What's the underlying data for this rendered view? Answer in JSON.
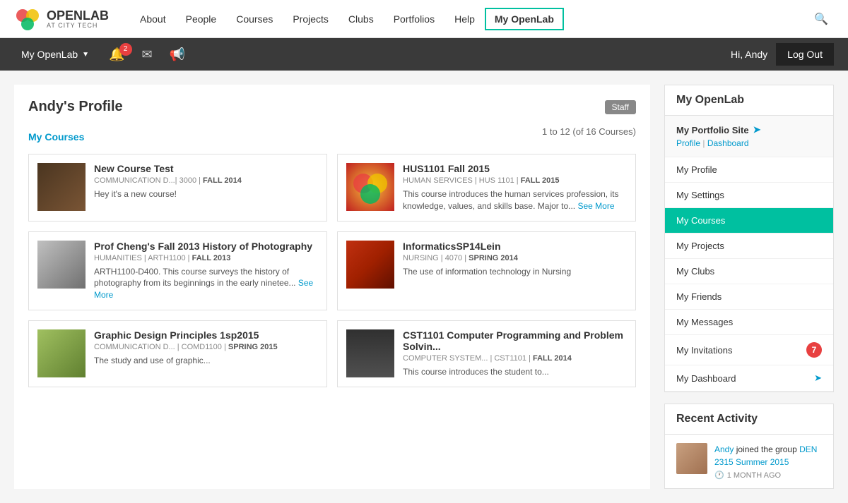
{
  "logo": {
    "openlab": "OPENLAB",
    "citytech": "AT CITY TECH"
  },
  "nav": {
    "links": [
      "About",
      "People",
      "Courses",
      "Projects",
      "Clubs",
      "Portfolios",
      "Help"
    ],
    "active": "My OpenLab",
    "search_icon": "🔍"
  },
  "secondary_nav": {
    "my_openlab": "My OpenLab",
    "notification_count": "2",
    "hi_text": "Hi, Andy",
    "logout": "Log Out"
  },
  "main": {
    "profile_title": "Andy's Profile",
    "staff_badge": "Staff",
    "my_courses_link": "My Courses",
    "courses_count": "1 to 12 (of 16 Courses)"
  },
  "courses": [
    {
      "name": "New Course Test",
      "meta_dept": "COMMUNICATION D...",
      "meta_code": "3000",
      "meta_term": "FALL 2014",
      "desc": "Hey it's a new course!",
      "img_class": "img-placeholder-1"
    },
    {
      "name": "HUS1101 Fall 2015",
      "meta_dept": "HUMAN SERVICES",
      "meta_code": "HUS 1101",
      "meta_term": "FALL 2015",
      "desc": "This course introduces the human services profession, its knowledge, values, and skills base. Major to...",
      "desc_link": "See More",
      "img_class": "img-placeholder-2"
    },
    {
      "name": "Prof Cheng's Fall 2013 History of Photography",
      "meta_dept": "HUMANITIES",
      "meta_code": "ARTH1100",
      "meta_term": "FALL 2013",
      "desc": "ARTH1100-D400. This course surveys the history of photography from its beginnings in the early ninetee...",
      "desc_link": "See More",
      "img_class": "img-placeholder-3"
    },
    {
      "name": "InformaticsSP14Lein",
      "meta_dept": "NURSING",
      "meta_code": "4070",
      "meta_term": "SPRING 2014",
      "desc": "The use of information technology in Nursing",
      "img_class": "img-placeholder-4"
    },
    {
      "name": "Graphic Design Principles 1sp2015",
      "meta_dept": "COMMUNICATION D...",
      "meta_code": "COMD1100",
      "meta_term": "SPRING 2015",
      "desc": "The study and use of graphic...",
      "img_class": "img-placeholder-5"
    },
    {
      "name": "CST1101 Computer Programming and Problem Solvin...",
      "meta_dept": "COMPUTER SYSTEM...",
      "meta_code": "CST1101",
      "meta_term": "FALL 2014",
      "desc": "This course introduces the student to...",
      "img_class": "img-placeholder-6"
    }
  ],
  "sidebar": {
    "title": "My OpenLab",
    "portfolio_label": "My Portfolio Site",
    "portfolio_profile": "Profile",
    "portfolio_dashboard": "Dashboard",
    "items": [
      {
        "label": "My Profile",
        "active": false
      },
      {
        "label": "My Settings",
        "active": false
      },
      {
        "label": "My Courses",
        "active": true
      },
      {
        "label": "My Projects",
        "active": false
      },
      {
        "label": "My Clubs",
        "active": false
      },
      {
        "label": "My Friends",
        "active": false
      },
      {
        "label": "My Messages",
        "active": false
      },
      {
        "label": "My Invitations",
        "active": false,
        "badge": "7"
      },
      {
        "label": "My Dashboard",
        "active": false,
        "arrow": true
      }
    ]
  },
  "recent_activity": {
    "title": "Recent Activity",
    "items": [
      {
        "user": "Andy",
        "action": "joined the group",
        "group": "DEN 2315 Summer 2015",
        "time": "1 MONTH AGO"
      }
    ]
  }
}
